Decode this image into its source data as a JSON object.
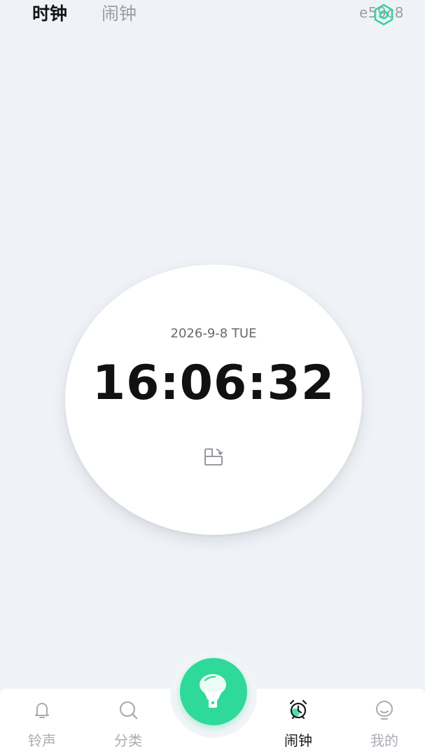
{
  "top_tabs": [
    {
      "label": "时钟",
      "active": true
    },
    {
      "label": "闹钟",
      "active": false
    }
  ],
  "top_right": {
    "code": "e59c8",
    "icon": "gear-icon"
  },
  "clock": {
    "date": "2026-9-8 TUE",
    "time": "16:06:32",
    "rotate_icon": "screen-rotate-icon"
  },
  "fab": {
    "icon": "microphone-icon",
    "color": "#2fd99a"
  },
  "bottom_nav": [
    {
      "label": "铃声",
      "icon": "bell-icon",
      "active": false
    },
    {
      "label": "分类",
      "icon": "search-icon",
      "active": false
    },
    {
      "label": "闹钟",
      "icon": "alarm-clock-icon",
      "active": true
    },
    {
      "label": "我的",
      "icon": "profile-icon",
      "active": false
    }
  ],
  "colors": {
    "accent": "#2fd99a",
    "background": "#eff3f8",
    "inactive": "#a9adb2"
  }
}
